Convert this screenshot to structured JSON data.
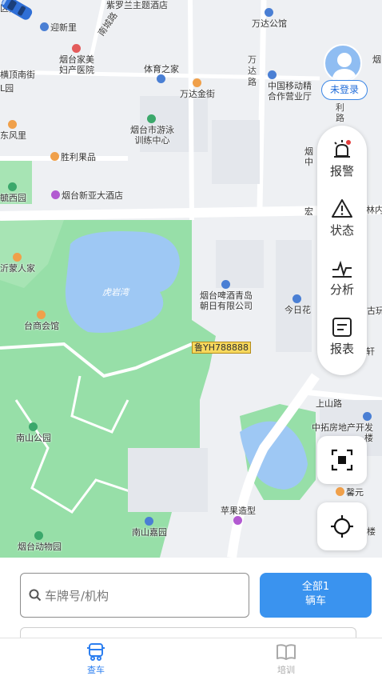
{
  "map": {
    "pois": [
      {
        "id": "ziluolan",
        "text": "紫罗兰主题酒店",
        "icon": "none"
      },
      {
        "id": "qu",
        "text": "区)",
        "icon": "none"
      },
      {
        "id": "wanda-gongguan",
        "text": "万达公馆",
        "icon": "blue"
      },
      {
        "id": "yingxinli",
        "text": "迎新里",
        "icon": "blue"
      },
      {
        "id": "hospital",
        "text": "烟台家美\n妇产医院",
        "icon": "red"
      },
      {
        "id": "hengding",
        "text": "横顶南街",
        "icon": "none"
      },
      {
        "id": "l-yuan",
        "text": "L园",
        "icon": "none"
      },
      {
        "id": "tiyu",
        "text": "体育之家",
        "icon": "blue"
      },
      {
        "id": "wanda-jinjie",
        "text": "万达金街",
        "icon": "orange"
      },
      {
        "id": "yan",
        "text": "烟",
        "icon": "none"
      },
      {
        "id": "mobile",
        "text": "中国移动精\n合作营业厅",
        "icon": "blue"
      },
      {
        "id": "dongfengli",
        "text": "东风里",
        "icon": "orange"
      },
      {
        "id": "swim",
        "text": "烟台市游泳\n训练中心",
        "icon": "green"
      },
      {
        "id": "shengli",
        "text": "胜利果品",
        "icon": "orange"
      },
      {
        "id": "yan-zhong",
        "text": "烟\n中",
        "icon": "none"
      },
      {
        "id": "xiyuan",
        "text": "毓西园",
        "icon": "green"
      },
      {
        "id": "xinya",
        "text": "烟台新亚大酒店",
        "icon": "purple"
      },
      {
        "id": "hong",
        "text": "宏",
        "icon": "none"
      },
      {
        "id": "linnei",
        "text": "林内",
        "icon": "none"
      },
      {
        "id": "yimeng",
        "text": "沂蒙人家",
        "icon": "orange"
      },
      {
        "id": "beer",
        "text": "烟台啤酒青岛\n朝日有限公司",
        "icon": "blue"
      },
      {
        "id": "jinrihua",
        "text": "今日花",
        "icon": "blue"
      },
      {
        "id": "gu",
        "text": "古玩",
        "icon": "none"
      },
      {
        "id": "taishang",
        "text": "台商会馆",
        "icon": "orange"
      },
      {
        "id": "xuan",
        "text": "轩",
        "icon": "none"
      },
      {
        "id": "shangshan",
        "text": "上山路",
        "icon": "none"
      },
      {
        "id": "zhongtuo",
        "text": "中拓房地产开发\n楼",
        "icon": "blue"
      },
      {
        "id": "nanshan-park",
        "text": "南山公园",
        "icon": "green"
      },
      {
        "id": "xinyuan",
        "text": "馨元",
        "icon": "orange"
      },
      {
        "id": "apple",
        "text": "苹果造型",
        "icon": "purple"
      },
      {
        "id": "lou",
        "text": "楼",
        "icon": "none"
      },
      {
        "id": "nanshan-jiayuan",
        "text": "南山嘉园",
        "icon": "blue"
      },
      {
        "id": "zoo",
        "text": "烟台动物园",
        "icon": "green"
      }
    ],
    "roads": {
      "wanda_road": "万\n达\n路",
      "lijiao": "利\n路",
      "nancheng": "南城路"
    },
    "lake_label": "虎岩湾",
    "plate": "鲁YH788888"
  },
  "avatar": {
    "login_label": "未登录"
  },
  "side_panel": {
    "items": [
      {
        "label": "报警",
        "icon": "alarm-icon"
      },
      {
        "label": "状态",
        "icon": "warning-icon"
      },
      {
        "label": "分析",
        "icon": "analysis-icon"
      },
      {
        "label": "报表",
        "icon": "report-icon"
      }
    ]
  },
  "search": {
    "placeholder": "车牌号/机构",
    "value": ""
  },
  "all_button": {
    "line1": "全部1",
    "line2": "辆车"
  },
  "tabbar": {
    "tabs": [
      {
        "label": "查车",
        "active": true
      },
      {
        "label": "培训",
        "active": false
      }
    ]
  },
  "colors": {
    "accent": "#3a93ef",
    "active_tab": "#2d7ff0",
    "inactive_tab": "#a9a9a9",
    "park_green": "#97dfa8",
    "lake_blue": "#9ec8f4"
  }
}
